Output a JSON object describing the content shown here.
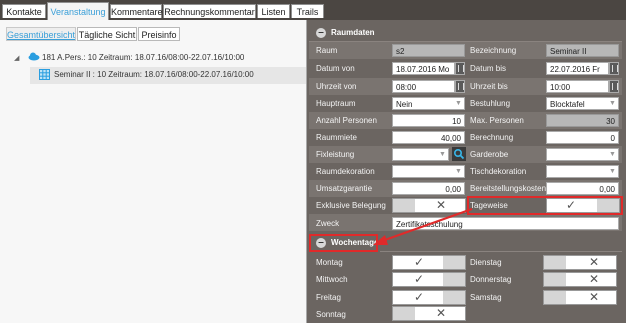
{
  "tabs": [
    "Kontakte",
    "Veranstaltung",
    "Kommentare",
    "Rechnungskommentar",
    "Listen",
    "Trails"
  ],
  "left": {
    "subtabs": [
      "Gesamtübersicht",
      "Tägliche Sicht",
      "Preisinfo"
    ],
    "tree_root": "181 A.Pers.: 10 Zeitraum: 18.07.16/08:00-22.07.16/10:00",
    "tree_child": "Seminar II : 10 Zeitraum: 18.07.16/08:00-22.07.16/10:00"
  },
  "raumdaten": {
    "title": "Raumdaten",
    "rows": [
      {
        "l1": "Raum",
        "v1": "s2",
        "l2": "Bezeichnung",
        "v2": "Seminar II"
      },
      {
        "l1": "Datum von",
        "v1": "18.07.2016 Mo",
        "l2": "Datum bis",
        "v2": "22.07.2016 Fr"
      },
      {
        "l1": "Uhrzeit von",
        "v1": "08:00",
        "l2": "Uhrzeit bis",
        "v2": "10:00"
      },
      {
        "l1": "Hauptraum",
        "v1": "Nein",
        "l2": "Bestuhlung",
        "v2": "Blocktafel"
      },
      {
        "l1": "Anzahl Personen",
        "v1": "10",
        "l2": "Max. Personen",
        "v2": "30"
      },
      {
        "l1": "Raummiete",
        "v1": "40,00",
        "l2": "Berechnung",
        "v2": "0"
      },
      {
        "l1": "Fixleistung",
        "v1": "",
        "l2": "Garderobe",
        "v2": ""
      },
      {
        "l1": "Raumdekoration",
        "v1": "",
        "l2": "Tischdekoration",
        "v2": ""
      },
      {
        "l1": "Umsatzgarantie",
        "v1": "0,00",
        "l2": "Bereitstellungskosten",
        "v2": "0,00"
      },
      {
        "l1": "Exklusive Belegung",
        "v1": "",
        "l2": "Tageweise",
        "v2": ""
      },
      {
        "l1": "Zweck",
        "v1": "Zertifikatsschulung",
        "l2": "",
        "v2": ""
      }
    ]
  },
  "wochentage": {
    "title": "Wochentage",
    "days": [
      {
        "name": "Montag",
        "checked": true
      },
      {
        "name": "Dienstag",
        "checked": false
      },
      {
        "name": "Mittwoch",
        "checked": true
      },
      {
        "name": "Donnerstag",
        "checked": false
      },
      {
        "name": "Freitag",
        "checked": true
      },
      {
        "name": "Samstag",
        "checked": false
      },
      {
        "name": "Sonntag",
        "checked": false
      }
    ]
  },
  "colors": {
    "accent": "#3a9fd8",
    "annotation": "#e02a2a",
    "panel": "#6b6561"
  }
}
